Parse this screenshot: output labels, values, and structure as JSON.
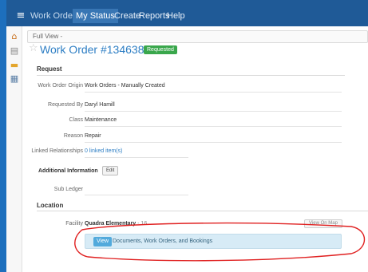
{
  "app": {
    "nav": {
      "work_orders": "Work Orders",
      "my_status": "My Status",
      "create": "Create",
      "reports": "Reports",
      "help": "Help"
    }
  },
  "toolbar": {
    "view_selector": "Full View -"
  },
  "work_order": {
    "title": "Work Order #134638",
    "status": "Requested",
    "status_color": "#3aa74c"
  },
  "request": {
    "heading": "Request",
    "origin_label": "Work Order Origin",
    "origin_value": "Work Orders - Manually Created",
    "requested_by_label": "Requested By",
    "requested_by_value": "Daryl Hamill",
    "class_label": "Class",
    "class_value": "Maintenance",
    "reason_label": "Reason",
    "reason_value": "Repair",
    "linked_label": "Linked Relationships",
    "linked_value": "0 linked item(s)"
  },
  "additional": {
    "heading": "Additional Information",
    "edit_label": "Edit",
    "sub_ledger_label": "Sub Ledger",
    "sub_ledger_value": ""
  },
  "location": {
    "heading": "Location",
    "facility_label": "Facility",
    "facility_value": "Quadra Elementary",
    "facility_suffix": "- 16",
    "view_on_map": "View On Map"
  },
  "documents": {
    "view_label": "View",
    "text": "Documents, Work Orders, and Bookings"
  },
  "icons": {
    "menu": "hamburger-icon",
    "rail": [
      "home-icon",
      "document-icon",
      "folder-icon",
      "list-icon"
    ]
  },
  "colors": {
    "topbar": "#1f5a97",
    "accent": "#2d7ec4",
    "annotation": "#e02020"
  }
}
